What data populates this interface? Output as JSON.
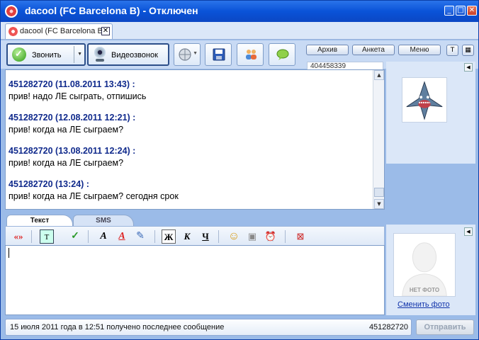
{
  "window": {
    "title": "dacool (FC Barcelona B) - Отключен",
    "controls": {
      "minimize": "_",
      "maximize": "□",
      "close": "✕"
    }
  },
  "tab": {
    "label": "dacool (FC Barcelona B)",
    "close": "✕"
  },
  "toolbar": {
    "call_label": "Звонить",
    "video_label": "Видеозвонок",
    "archive_label": "Архив",
    "profile_label": "Анкета",
    "menu_label": "Меню"
  },
  "chat": {
    "contact_id": "404458339",
    "messages": [
      {
        "header": "451282720 (11.08.2011 13:43) :",
        "text": "прив! надо ЛЕ сыграть, отпишись"
      },
      {
        "header": "451282720 (12.08.2011 12:21) :",
        "text": "прив! когда на ЛЕ сыграем?"
      },
      {
        "header": "451282720 (13.08.2011 12:24) :",
        "text": "прив! когда на ЛЕ сыграем?"
      },
      {
        "header": "451282720 (13:24) :",
        "text": "прив! когда на ЛЕ сыграем? сегодня срок"
      }
    ]
  },
  "editor": {
    "tabs": [
      "Текст",
      "SMS"
    ],
    "format": {
      "bold": "Ж",
      "italic": "К",
      "underline": "Ч"
    },
    "value": ""
  },
  "side": {
    "no_photo": "НЕТ ФОТО",
    "change_photo": "Сменить фото"
  },
  "status": {
    "message": "15 июля 2011 года в 12:51 получено последнее сообщение",
    "uin": "451282720",
    "send_label": "Отправить"
  },
  "colors": {
    "titlebar": "#0a53d8",
    "message_header": "#102a8c",
    "link": "#1133aa",
    "panel_bg": "#dbe7f8"
  }
}
